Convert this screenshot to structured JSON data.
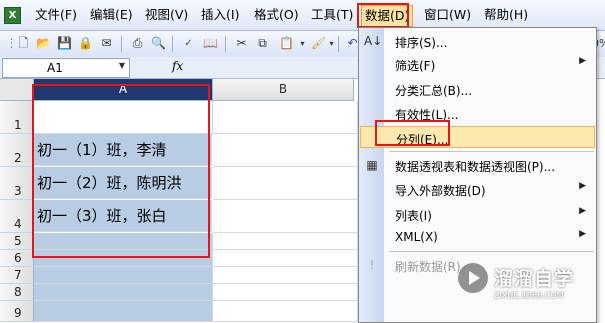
{
  "menubar": {
    "items": [
      "文件(F)",
      "编辑(E)",
      "视图(V)",
      "插入(I)",
      "格式(O)",
      "工具(T)",
      "数据(D)",
      "窗口(W)",
      "帮助(H)"
    ],
    "active_item": "数据(D)"
  },
  "toolbar": {
    "icons": [
      "new-icon",
      "open-icon",
      "save-icon",
      "permission-icon",
      "email-icon",
      "print-icon",
      "print-preview-icon",
      "spelling-icon",
      "research-icon",
      "cut-icon",
      "copy-icon",
      "paste-icon",
      "format-painter-icon",
      "undo-icon"
    ],
    "zoom_partial": "0%"
  },
  "formula_bar": {
    "name_box": "A1",
    "fx_label": "fx"
  },
  "grid": {
    "columns": [
      "A",
      "B"
    ],
    "rows": [
      "1",
      "2",
      "3",
      "4",
      "5",
      "6",
      "7",
      "8",
      "9"
    ],
    "cells": {
      "A2": "初一（1）班，李清",
      "A3": "初一（2）班，陈明洪",
      "A4": "初一（3）班，张白"
    }
  },
  "data_menu": {
    "items": [
      {
        "label": "排序(S)...",
        "icon": "sort-icon",
        "submenu": false
      },
      {
        "label": "筛选(F)",
        "icon": "",
        "submenu": true
      },
      {
        "label": "分类汇总(B)...",
        "icon": "",
        "submenu": false
      },
      {
        "label": "有效性(L)...",
        "icon": "",
        "submenu": false
      },
      {
        "label": "分列(E)...",
        "icon": "",
        "submenu": false,
        "highlighted": true
      },
      {
        "label": "数据透视表和数据透视图(P)...",
        "icon": "pivot-table-icon",
        "submenu": false
      },
      {
        "label": "导入外部数据(D)",
        "icon": "",
        "submenu": true
      },
      {
        "label": "列表(I)",
        "icon": "",
        "submenu": true
      },
      {
        "label": "XML(X)",
        "icon": "",
        "submenu": true
      },
      {
        "label": "刷新数据(R)",
        "icon": "refresh-icon",
        "submenu": false,
        "disabled": true
      }
    ]
  },
  "watermark": {
    "title": "溜溜自学",
    "subtitle": "ZIXUE.3D66.COM"
  },
  "colors": {
    "highlight": "#e2161b",
    "menu_hover": "#fbe2a0",
    "selection": "#b8cce4",
    "header_selected": "#20386e"
  }
}
